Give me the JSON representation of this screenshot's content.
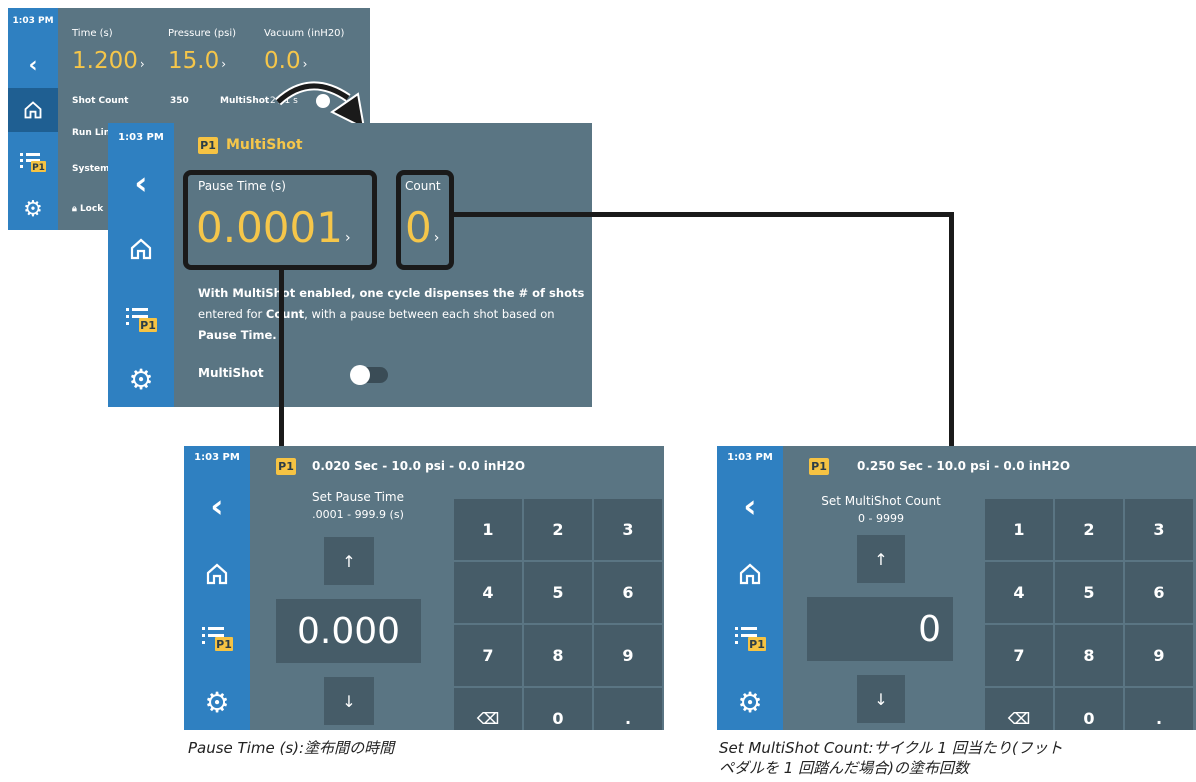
{
  "s1": {
    "time": "1:03 PM",
    "time_label": "Time (s)",
    "time_value": "1.200",
    "pressure_label": "Pressure (psi)",
    "pressure_value": "15.0",
    "vacuum_label": "Vacuum (inH20)",
    "vacuum_value": "0.0",
    "shot_count_label": "Shot Count",
    "shot_count_value": "350",
    "multishot_label": "MultiShot",
    "multishot_value": "2 / 1 s",
    "run_limit_label": "Run Lin",
    "system_label": "System",
    "lock_label": "Lock"
  },
  "s2": {
    "time": "1:03 PM",
    "badge": "P1",
    "title": "MultiShot",
    "pause_label": "Pause Time (s)",
    "pause_value": "0.0001",
    "count_label": "Count",
    "count_value": "0",
    "desc_1": "With MultiShot enabled, one cycle dispenses the # of shots",
    "desc_2a": "entered for ",
    "desc_2b": "Count",
    "desc_2c": ", with a pause between each shot based on",
    "desc_3": "Pause Time",
    "desc_3b": ".",
    "toggle_label": "MultiShot"
  },
  "s3": {
    "time": "1:03 PM",
    "badge": "P1",
    "header": "0.020 Sec - 10.0 psi - 0.0 inH2O",
    "set_title": "Set Pause Time",
    "range": ".0001 - 999.9 (s)",
    "value": "0.000",
    "keys": [
      "1",
      "2",
      "3",
      "4",
      "5",
      "6",
      "7",
      "8",
      "9",
      "⌫",
      "0",
      "."
    ]
  },
  "s4": {
    "time": "1:03 PM",
    "badge": "P1",
    "header": "0.250 Sec - 10.0 psi - 0.0 inH2O",
    "set_title": "Set MultiShot Count",
    "range": "0 - 9999",
    "value": "0",
    "keys": [
      "1",
      "2",
      "3",
      "4",
      "5",
      "6",
      "7",
      "8",
      "9",
      "⌫",
      "0",
      "."
    ]
  },
  "captions": {
    "left": "Pause Time (s):塗布間の時間",
    "right_1": "Set MultiShot Count:サイクル 1 回当たり(フット",
    "right_2": "ペダルを 1 回踏んだ場合)の塗布回数"
  }
}
